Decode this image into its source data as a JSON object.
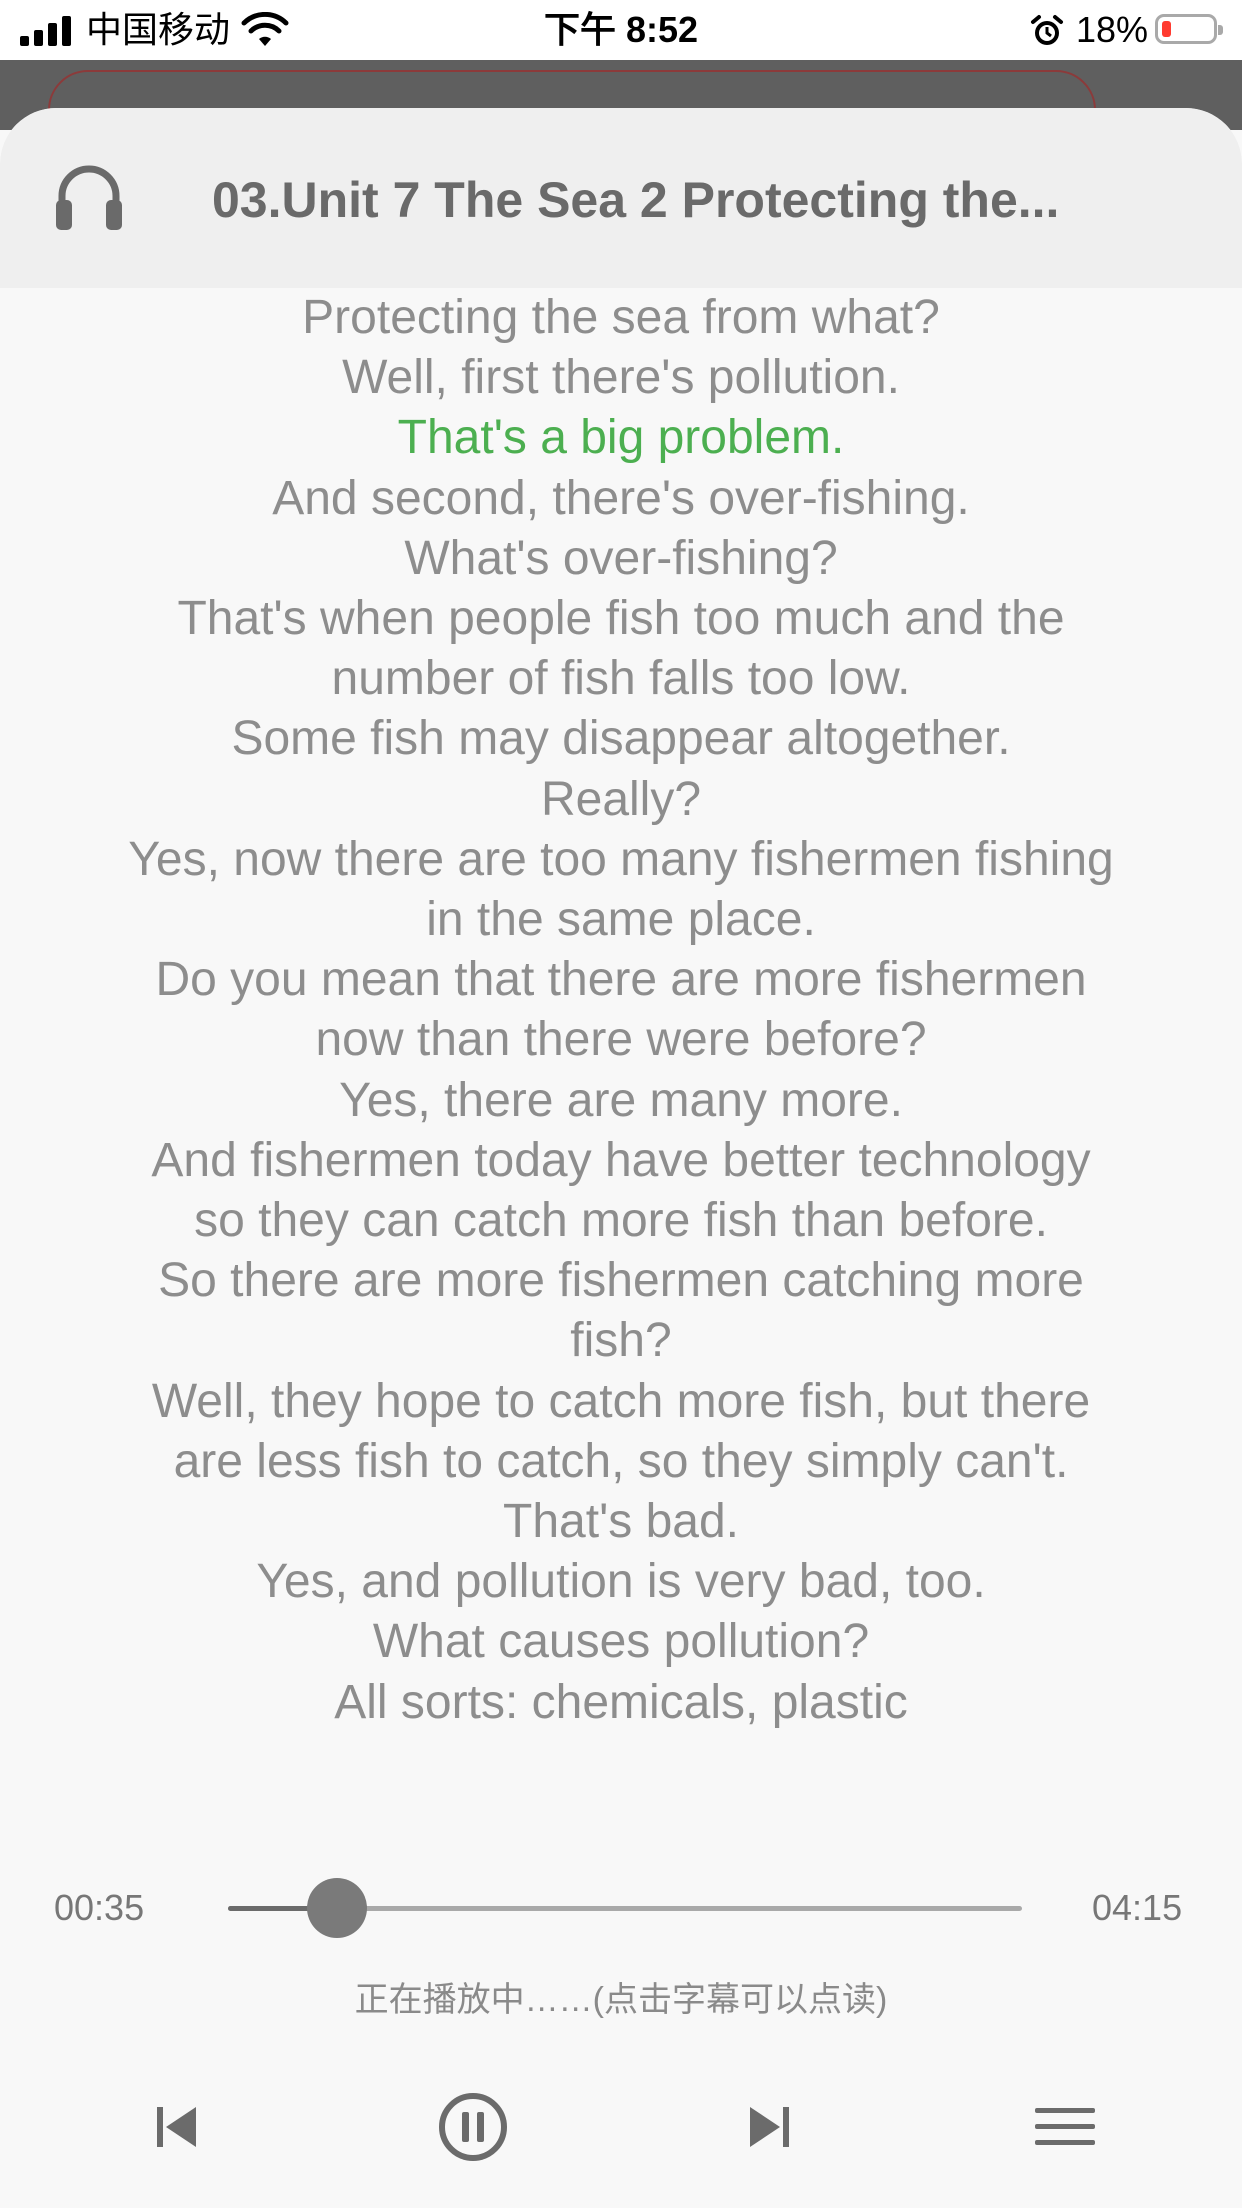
{
  "status_bar": {
    "carrier": "中国移动",
    "time": "下午 8:52",
    "battery_percent": "18%",
    "battery_level": 0.18
  },
  "header": {
    "icon": "headphones-icon",
    "title": "03.Unit 7 The Sea 2 Protecting the..."
  },
  "lyrics": {
    "active_index": 2,
    "lines": [
      "Protecting the sea from what?",
      "Well, first there's pollution.",
      "That's a big problem.",
      "And second, there's over-fishing.",
      "What's over-fishing?",
      "That's when people fish too much and the number of fish falls too low.",
      "Some fish may disappear altogether.",
      "Really?",
      "Yes, now there are too many fishermen fishing in the same place.",
      "Do you mean that there are more fishermen now than there were before?",
      "Yes, there are many more.",
      "And fishermen today have better technology so they can catch more fish than before.",
      "So there are more fishermen catching more fish?",
      "Well, they hope to catch more fish, but there are less fish to catch, so they simply can't.",
      "That's bad.",
      "Yes, and pollution is very bad, too.",
      "What causes pollution?",
      "All sorts: chemicals, plastic"
    ]
  },
  "player": {
    "current_time": "00:35",
    "total_time": "04:15",
    "progress": 0.137,
    "status_hint": "正在播放中……(点击字幕可以点读)",
    "controls": [
      "previous-icon",
      "pause-icon",
      "next-icon",
      "menu-icon"
    ]
  },
  "colors": {
    "active_lyric": "#4caf50",
    "lyric_text": "#8d8d8d",
    "header_bg": "#efefef",
    "page_bg": "#f8f8f8"
  }
}
